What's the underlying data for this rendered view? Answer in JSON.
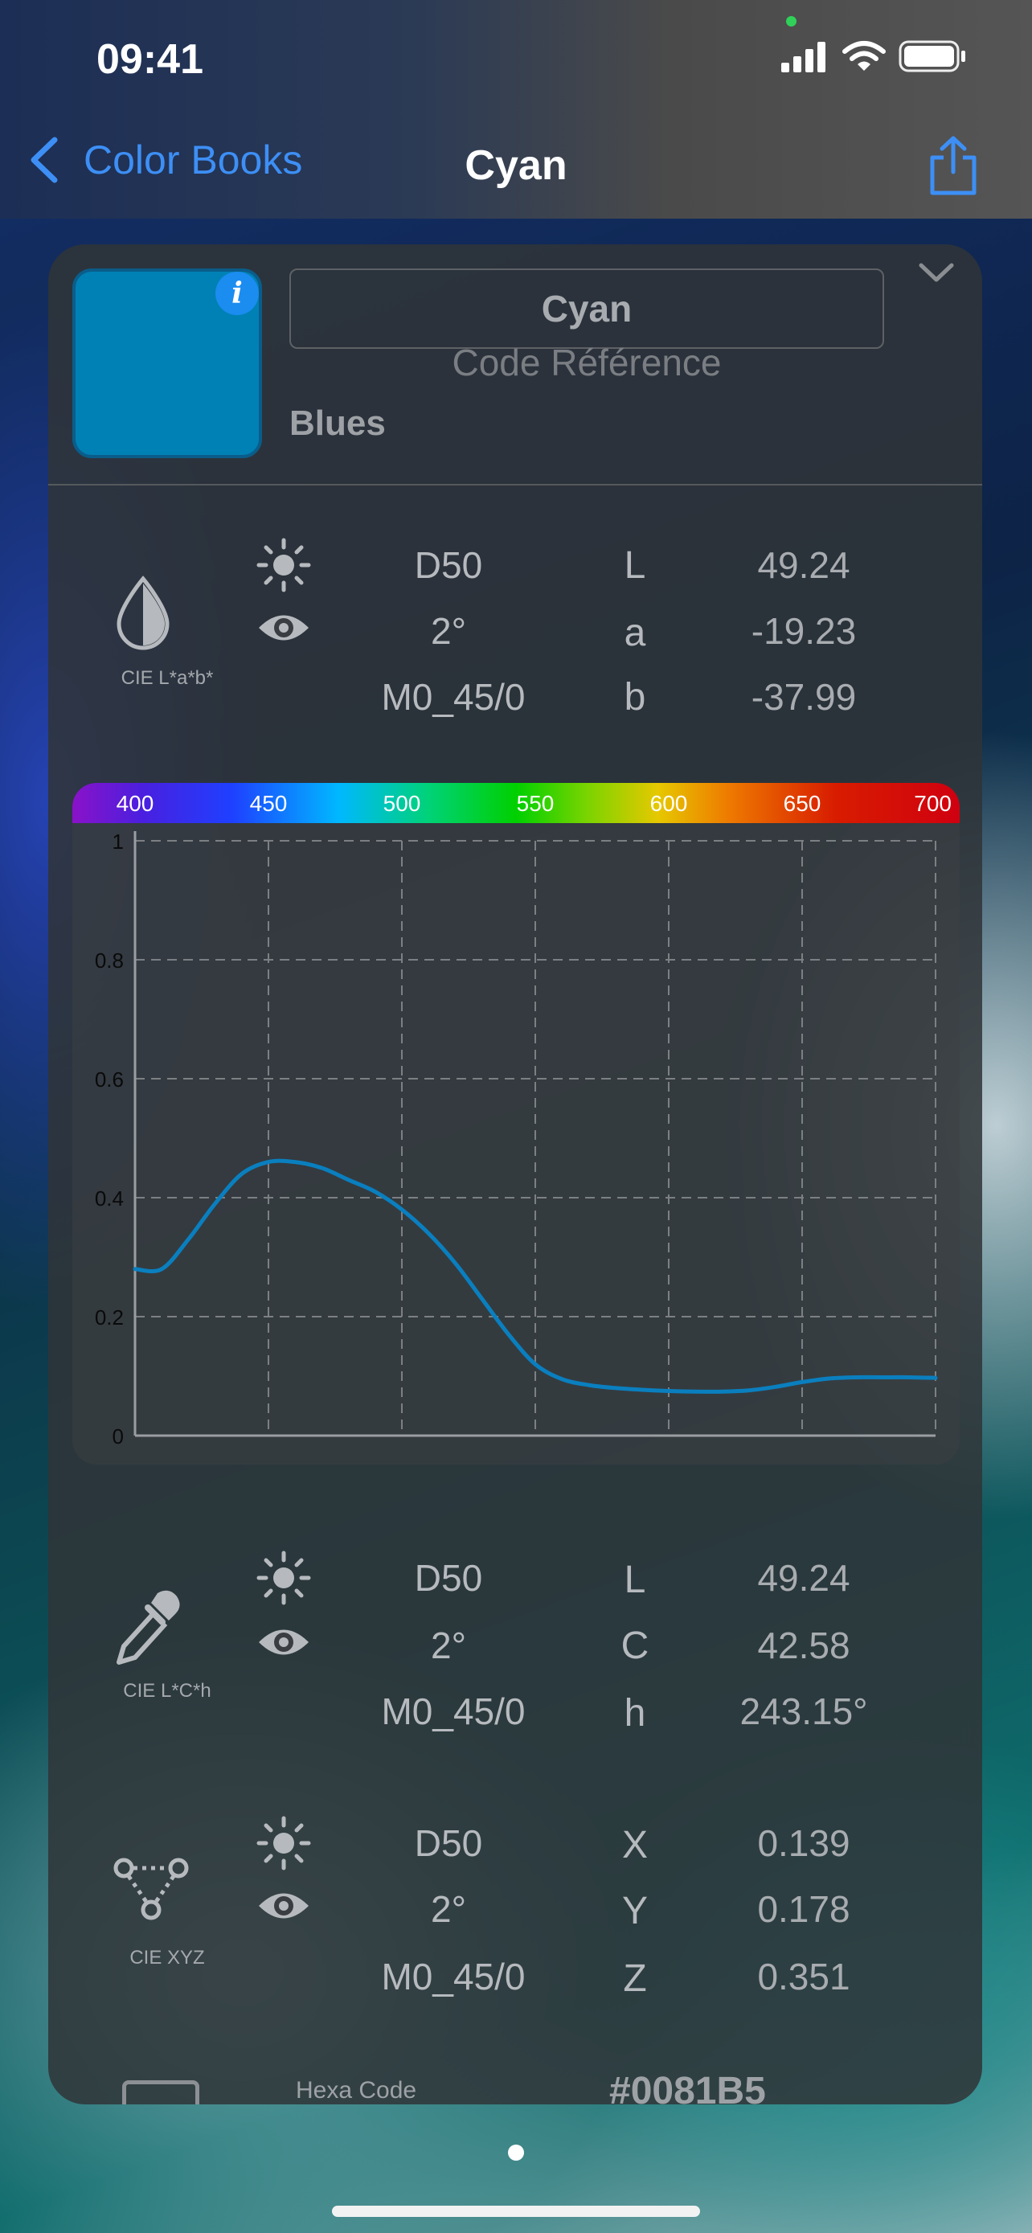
{
  "status_bar": {
    "time": "09:41"
  },
  "nav": {
    "back_label": "Color Books",
    "title": "Cyan"
  },
  "swatch": {
    "color": "#0081B5",
    "info_icon": "i"
  },
  "color_name": "Cyan",
  "code_placeholder": "Code Référence",
  "category": "Blues",
  "lab_section": {
    "label": "CIE L*a*b*",
    "illuminant": "D50",
    "observer": "2°",
    "mode": "M0_45/0",
    "rows": [
      {
        "key": "L",
        "value": "49.24"
      },
      {
        "key": "a",
        "value": "-19.23"
      },
      {
        "key": "b",
        "value": "-37.99"
      }
    ]
  },
  "chart_data": {
    "type": "line",
    "x_ticks": [
      "400",
      "450",
      "500",
      "550",
      "600",
      "650",
      "700"
    ],
    "y_ticks": [
      "0",
      "0.2",
      "0.4",
      "0.6",
      "0.8",
      "1"
    ],
    "ylim": [
      0,
      1
    ],
    "xlim": [
      400,
      700
    ],
    "grid": true,
    "series": [
      {
        "color": "#0a7fbf",
        "x": [
          400,
          410,
          420,
          430,
          440,
          450,
          460,
          470,
          480,
          490,
          500,
          510,
          520,
          530,
          540,
          550,
          560,
          570,
          580,
          590,
          600,
          610,
          620,
          630,
          640,
          650,
          660,
          670,
          680,
          690,
          700
        ],
        "y": [
          0.28,
          0.28,
          0.33,
          0.39,
          0.44,
          0.46,
          0.46,
          0.45,
          0.43,
          0.41,
          0.38,
          0.34,
          0.29,
          0.23,
          0.17,
          0.12,
          0.095,
          0.085,
          0.08,
          0.077,
          0.075,
          0.074,
          0.074,
          0.076,
          0.082,
          0.09,
          0.096,
          0.098,
          0.098,
          0.098,
          0.097
        ]
      }
    ]
  },
  "lch_section": {
    "label": "CIE L*C*h",
    "illuminant": "D50",
    "observer": "2°",
    "mode": "M0_45/0",
    "rows": [
      {
        "key": "L",
        "value": "49.24"
      },
      {
        "key": "C",
        "value": "42.58"
      },
      {
        "key": "h",
        "value": "243.15°"
      }
    ]
  },
  "xyz_section": {
    "label": "CIE XYZ",
    "illuminant": "D50",
    "observer": "2°",
    "mode": "M0_45/0",
    "rows": [
      {
        "key": "X",
        "value": "0.139"
      },
      {
        "key": "Y",
        "value": "0.178"
      },
      {
        "key": "Z",
        "value": "0.351"
      }
    ]
  },
  "hexa": {
    "label": "Hexa Code",
    "value": "#0081B5"
  },
  "icons": {
    "back": "chevron-left-icon",
    "share": "share-icon",
    "collapse": "chevron-down-icon",
    "drop": "drop-icon",
    "eyedropper": "eyedropper-icon",
    "xyz": "xyz-triangle-icon",
    "sun": "sun-icon",
    "eye": "eye-icon"
  }
}
